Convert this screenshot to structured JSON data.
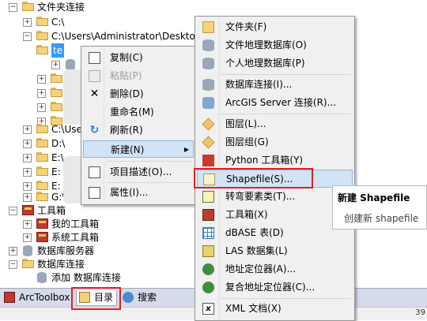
{
  "tree": {
    "nodes": [
      {
        "label": "文件夹连接",
        "exp": "−"
      },
      {
        "label": "C:\\",
        "exp": "+"
      },
      {
        "label": "C:\\Users\\Administrator\\Desktop",
        "exp": "−"
      },
      {
        "label": "te",
        "exp": ""
      },
      {
        "label": "",
        "exp": "+"
      },
      {
        "label": "",
        "exp": "+"
      },
      {
        "label": "",
        "exp": "+"
      },
      {
        "label": "",
        "exp": "+"
      },
      {
        "label": "C:\\Use",
        "exp": "+"
      },
      {
        "label": "D:\\",
        "exp": "+"
      },
      {
        "label": "E:\\",
        "exp": "+"
      },
      {
        "label": "E:",
        "exp": "+"
      },
      {
        "label": "E:",
        "exp": "+"
      },
      {
        "label": "G:\\",
        "exp": "+"
      },
      {
        "label": "工具箱",
        "exp": "−"
      },
      {
        "label": "我的工具箱",
        "exp": "+"
      },
      {
        "label": "系统工具箱",
        "exp": "+"
      },
      {
        "label": "数据库服务器",
        "exp": "+"
      },
      {
        "label": "数据库连接",
        "exp": "−"
      },
      {
        "label": "添加 数据库连接",
        "exp": ""
      }
    ]
  },
  "tabs": [
    {
      "label": "ArcToolbox"
    },
    {
      "label": "目录"
    },
    {
      "label": "搜索"
    }
  ],
  "status_text": "39",
  "context_menu": {
    "items": [
      {
        "label": "复制(C)",
        "icon": "copy-icon",
        "disabled": false
      },
      {
        "label": "粘贴(P)",
        "icon": "paste-icon",
        "disabled": true
      },
      {
        "label": "删除(D)",
        "icon": "delete-icon",
        "disabled": false
      },
      {
        "label": "重命名(M)",
        "icon": "",
        "disabled": false
      },
      {
        "label": "刷新(R)",
        "icon": "refresh-icon",
        "disabled": false
      },
      {
        "label": "新建(N)",
        "icon": "",
        "disabled": false,
        "arrow": "▶"
      },
      {
        "label": "项目描述(O)...",
        "icon": "item-description-icon",
        "disabled": false
      },
      {
        "label": "属性(I)...",
        "icon": "properties-icon",
        "disabled": false
      }
    ]
  },
  "new_submenu": {
    "items": [
      {
        "label": "文件夹(F)",
        "icon": "folder-icon"
      },
      {
        "label": "文件地理数据库(O)",
        "icon": "file-gdb-icon"
      },
      {
        "label": "个人地理数据库(P)",
        "icon": "personal-gdb-icon"
      },
      {
        "label": "数据库连接(I)...",
        "icon": "database-connection-icon"
      },
      {
        "label": "ArcGIS Server 连接(R)...",
        "icon": "arcgis-server-icon"
      },
      {
        "label": "图层(L)...",
        "icon": "layer-icon"
      },
      {
        "label": "图层组(G)",
        "icon": "group-layer-icon"
      },
      {
        "label": "Python 工具箱(Y)",
        "icon": "python-toolbox-icon"
      },
      {
        "label": "Shapefile(S)...",
        "icon": "shapefile-icon"
      },
      {
        "label": "转弯要素类(T)...",
        "icon": "turn-feature-class-icon"
      },
      {
        "label": "工具箱(X)",
        "icon": "toolbox-icon"
      },
      {
        "label": "dBASE 表(D)",
        "icon": "dbase-table-icon"
      },
      {
        "label": "LAS 数据集(L)",
        "icon": "las-dataset-icon"
      },
      {
        "label": "地址定位器(A)...",
        "icon": "address-locator-icon"
      },
      {
        "label": "复合地址定位器(C)...",
        "icon": "composite-locator-icon"
      },
      {
        "label": "XML 文档(X)",
        "icon": "xml-document-icon"
      }
    ]
  },
  "tooltip": {
    "title": "新建 Shapefile",
    "description": "创建新 shapefile"
  },
  "colors": {
    "highlight": "#d1e4f6",
    "annotation_red": "#e02020",
    "menu_bg": "#f0f0f0"
  }
}
